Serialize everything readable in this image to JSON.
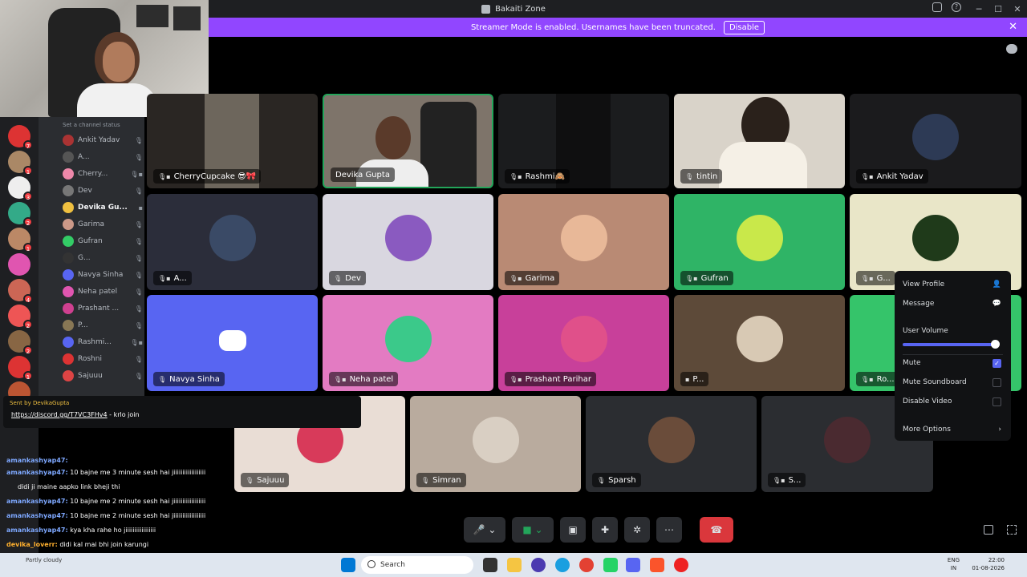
{
  "window": {
    "title": "Bakaiti Zone"
  },
  "banner": {
    "message": "Streamer Mode is enabled. Usernames have been truncated.",
    "disable_label": "Disable"
  },
  "sidebar": {
    "status_placeholder": "Set a channel status",
    "users": [
      {
        "name": "Ankit Yadav",
        "color": "#a33"
      },
      {
        "name": "A...",
        "color": "#555"
      },
      {
        "name": "Cherry...",
        "color": "#e8a"
      },
      {
        "name": "Dev",
        "color": "#777"
      },
      {
        "name": "Devika Gu...",
        "color": "#f0c040"
      },
      {
        "name": "Garima",
        "color": "#c98"
      },
      {
        "name": "Gufran",
        "color": "#3c6"
      },
      {
        "name": "G...",
        "color": "#333"
      },
      {
        "name": "Navya Sinha",
        "color": "#5865f2"
      },
      {
        "name": "Neha patel",
        "color": "#e055b0"
      },
      {
        "name": "Prashant ...",
        "color": "#d04090"
      },
      {
        "name": "P...",
        "color": "#875"
      },
      {
        "name": "Rashmi...",
        "color": "#5865f2"
      },
      {
        "name": "Roshni",
        "color": "#d33"
      },
      {
        "name": "Sajuuu",
        "color": "#d44"
      }
    ]
  },
  "tiles": [
    {
      "name": "CherryCupcake 😎🎀"
    },
    {
      "name": "Devika Gupta"
    },
    {
      "name": "Rashmi🙈"
    },
    {
      "name": "tintin"
    },
    {
      "name": "Ankit Yadav"
    },
    {
      "name": "A..."
    },
    {
      "name": "Dev"
    },
    {
      "name": "Garima"
    },
    {
      "name": "Gufran"
    },
    {
      "name": "G..."
    },
    {
      "name": "Navya Sinha"
    },
    {
      "name": "Neha patel"
    },
    {
      "name": "Prashant Parihar"
    },
    {
      "name": "P..."
    },
    {
      "name": "Ro..."
    },
    {
      "name": "Sajuuu"
    },
    {
      "name": "Simran"
    },
    {
      "name": "Sparsh"
    },
    {
      "name": "S..."
    }
  ],
  "context_menu": {
    "view_profile": "View Profile",
    "message": "Message",
    "user_volume": "User Volume",
    "volume_level": 1.0,
    "mute": "Mute",
    "mute_checked": true,
    "mute_soundboard": "Mute Soundboard",
    "disable_video": "Disable Video",
    "more_options": "More Options"
  },
  "pinned": {
    "sent_by": "Sent by",
    "sender": "DevikaGupta",
    "link": "https://discord.gg/T7VC3FHv4",
    "link_suffix": "- krlo join"
  },
  "chat": {
    "lines": [
      {
        "user": "amankashyap47:",
        "text": ""
      },
      {
        "user": "amankashyap47:",
        "text": "10 bajne me 3 minute sesh hai jiiiiiiiiiiiiiiiiii"
      },
      {
        "user": "",
        "text": "didi ji maine aapko link bheji thi"
      },
      {
        "user": "amankashyap47:",
        "text": "10 bajne me 2 minute sesh hai jiiiiiiiiiiiiiiiiii"
      },
      {
        "user": "amankashyap47:",
        "text": "10 bajne me 2 minute sesh hai jiiiiiiiiiiiiiiiiii"
      },
      {
        "user": "amankashyap47:",
        "text": "kya kha rahe ho jiiiiiiiiiiiiiiiii"
      },
      {
        "user": "devika_loverr:",
        "text": "didi kal mai bhi join karungi"
      }
    ]
  },
  "taskbar": {
    "weather": "Partly cloudy",
    "search_placeholder": "Search",
    "lang_1": "ENG",
    "lang_2": "IN",
    "time": "22:00",
    "date": "01-08-2026"
  }
}
